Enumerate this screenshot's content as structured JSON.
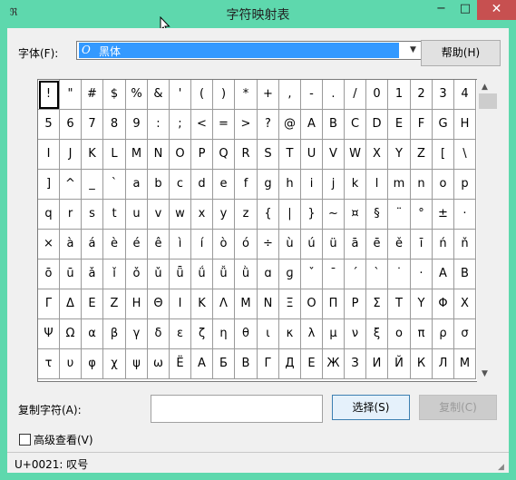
{
  "window": {
    "title": "字符映射表",
    "minimize_glyph": "−",
    "maximize_glyph": "□",
    "close_glyph": "✕",
    "close_color": "#c75050"
  },
  "font": {
    "label": "字体(F):",
    "selected_value": "黑体",
    "font_icon_glyph": "O",
    "dropdown_glyph": "▼"
  },
  "help_button": "帮助(H)",
  "characters": [
    [
      "!",
      "\"",
      "#",
      "$",
      "%",
      "&",
      "'",
      "(",
      ")",
      "*",
      "+",
      ",",
      "-",
      ".",
      "/",
      "0",
      "1",
      "2",
      "3",
      "4"
    ],
    [
      "5",
      "6",
      "7",
      "8",
      "9",
      ":",
      ";",
      "<",
      "=",
      ">",
      "?",
      "@",
      "A",
      "B",
      "C",
      "D",
      "E",
      "F",
      "G",
      "H"
    ],
    [
      "I",
      "J",
      "K",
      "L",
      "M",
      "N",
      "O",
      "P",
      "Q",
      "R",
      "S",
      "T",
      "U",
      "V",
      "W",
      "X",
      "Y",
      "Z",
      "[",
      "\\"
    ],
    [
      "]",
      "^",
      "_",
      "`",
      "a",
      "b",
      "c",
      "d",
      "e",
      "f",
      "g",
      "h",
      "i",
      "j",
      "k",
      "l",
      "m",
      "n",
      "o",
      "p"
    ],
    [
      "q",
      "r",
      "s",
      "t",
      "u",
      "v",
      "w",
      "x",
      "y",
      "z",
      "{",
      "|",
      "}",
      "~",
      "¤",
      "§",
      "¨",
      "°",
      "±",
      "·"
    ],
    [
      "×",
      "à",
      "á",
      "è",
      "é",
      "ê",
      "ì",
      "í",
      "ò",
      "ó",
      "÷",
      "ù",
      "ú",
      "ü",
      "ā",
      "ē",
      "ě",
      "ī",
      "ń",
      "ň"
    ],
    [
      "ō",
      "ū",
      "ǎ",
      "ǐ",
      "ǒ",
      "ǔ",
      "ǖ",
      "ǘ",
      "ǚ",
      "ǜ",
      "ɑ",
      "ɡ",
      "ˇ",
      "ˉ",
      "ˊ",
      "ˋ",
      "˙",
      "·",
      "Α",
      "Β"
    ],
    [
      "Γ",
      "Δ",
      "Ε",
      "Ζ",
      "Η",
      "Θ",
      "Ι",
      "Κ",
      "Λ",
      "Μ",
      "Ν",
      "Ξ",
      "Ο",
      "Π",
      "Ρ",
      "Σ",
      "Τ",
      "Υ",
      "Φ",
      "Χ"
    ],
    [
      "Ψ",
      "Ω",
      "α",
      "β",
      "γ",
      "δ",
      "ε",
      "ζ",
      "η",
      "θ",
      "ι",
      "κ",
      "λ",
      "μ",
      "ν",
      "ξ",
      "ο",
      "π",
      "ρ",
      "σ"
    ],
    [
      "τ",
      "υ",
      "φ",
      "χ",
      "ψ",
      "ω",
      "Ё",
      "А",
      "Б",
      "В",
      "Г",
      "Д",
      "Е",
      "Ж",
      "З",
      "И",
      "Й",
      "К",
      "Л",
      "М"
    ]
  ],
  "selected_character": "!",
  "scrollbar": {
    "up_glyph": "▲",
    "down_glyph": "▼"
  },
  "copy": {
    "label": "复制字符(A):",
    "value": "",
    "select_button": "选择(S)",
    "copy_button": "复制(C)"
  },
  "advanced_view": {
    "label": "高级查看(V)",
    "checked": false
  },
  "status": "U+0021: 叹号",
  "app_icon_glyph": "ℜ"
}
